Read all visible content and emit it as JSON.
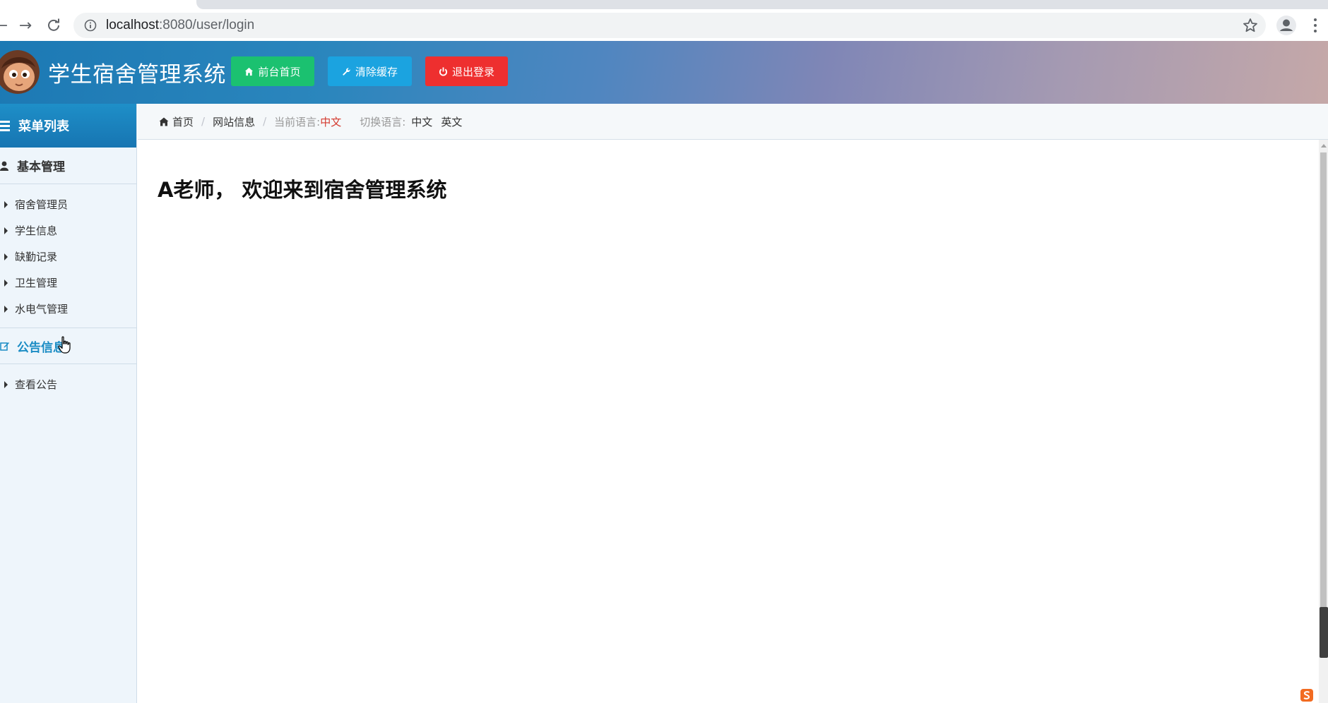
{
  "browser": {
    "url_host": "localhost",
    "url_path": ":8080/user/login"
  },
  "header": {
    "title": "学生宿舍管理系统",
    "buttons": {
      "home": "前台首页",
      "clear_cache": "清除缓存",
      "logout": "退出登录"
    },
    "colors": {
      "green": "#1bc170",
      "blue": "#1ba3e0",
      "red": "#ee2f2f"
    }
  },
  "sidebar": {
    "heading": "菜单列表",
    "groups": [
      {
        "title": "基本管理",
        "items": [
          "宿舍管理员",
          "学生信息",
          "缺勤记录",
          "卫生管理",
          "水电气管理"
        ]
      },
      {
        "title": "公告信息",
        "items": [
          "查看公告"
        ]
      }
    ]
  },
  "breadcrumb": {
    "home": "首页",
    "site_info": "网站信息",
    "current_lang_label": "当前语言:",
    "current_lang": "中文",
    "switch_lang_label": "切换语言:",
    "lang_zh": "中文",
    "lang_en": "英文"
  },
  "main": {
    "welcome": "A老师， 欢迎来到宿舍管理系统"
  }
}
